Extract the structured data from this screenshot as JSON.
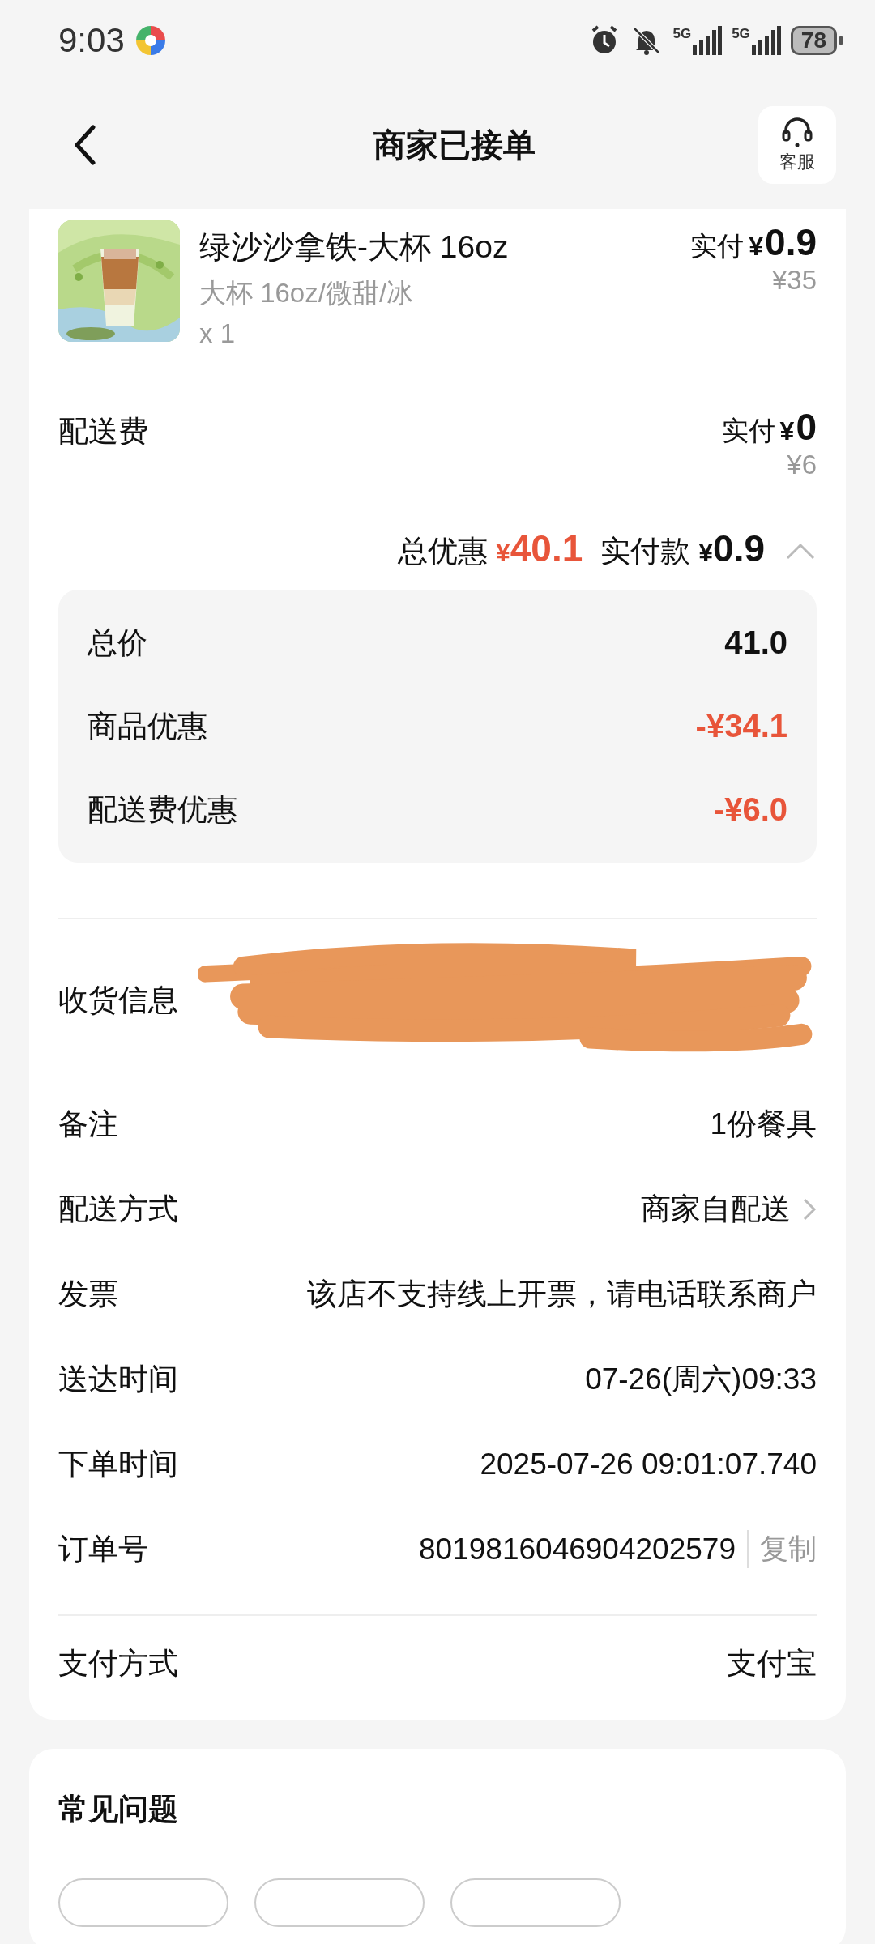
{
  "status_bar": {
    "time": "9:03",
    "networks": [
      "5G",
      "5G"
    ],
    "battery": "78"
  },
  "header": {
    "title": "商家已接单",
    "service_label": "客服"
  },
  "item": {
    "name": "绿沙沙拿铁-大杯 16oz",
    "spec": "大杯 16oz/微甜/冰",
    "quantity": "x 1",
    "paid_label": "实付",
    "currency": "¥",
    "paid": "0.9",
    "original": "¥35"
  },
  "delivery_fee": {
    "label": "配送费",
    "paid_label": "实付",
    "currency": "¥",
    "paid": "0",
    "original": "¥6"
  },
  "summary": {
    "discount_label": "总优惠",
    "discount_currency": "¥",
    "discount": "40.1",
    "paid_label": "实付款",
    "paid_currency": "¥",
    "paid": "0.9",
    "expanded": true,
    "breakdown": [
      {
        "label": "总价",
        "value": "41.0",
        "kind": "total"
      },
      {
        "label": "商品优惠",
        "value": "-¥34.1",
        "kind": "discount"
      },
      {
        "label": "配送费优惠",
        "value": "-¥6.0",
        "kind": "discount"
      }
    ]
  },
  "details": [
    {
      "label": "收货信息",
      "kind": "redacted"
    },
    {
      "label": "备注",
      "value": "1份餐具",
      "kind": "text"
    },
    {
      "label": "配送方式",
      "value": "商家自配送",
      "kind": "link"
    },
    {
      "label": "发票",
      "value": "该店不支持线上开票，请电话联系商户",
      "kind": "text"
    },
    {
      "label": "送达时间",
      "value": "07-26(周六)09:33",
      "kind": "text"
    },
    {
      "label": "下单时间",
      "value": "2025-07-26 09:01:07.740",
      "kind": "text"
    },
    {
      "label": "订单号",
      "value": "8019816046904202579",
      "action": "复制",
      "kind": "copy"
    }
  ],
  "payment": {
    "label": "支付方式",
    "value": "支付宝"
  },
  "faq": {
    "title": "常见问题",
    "chips": [
      {
        "kind": "chip"
      },
      {
        "kind": "chip"
      },
      {
        "kind": "chip"
      }
    ]
  }
}
